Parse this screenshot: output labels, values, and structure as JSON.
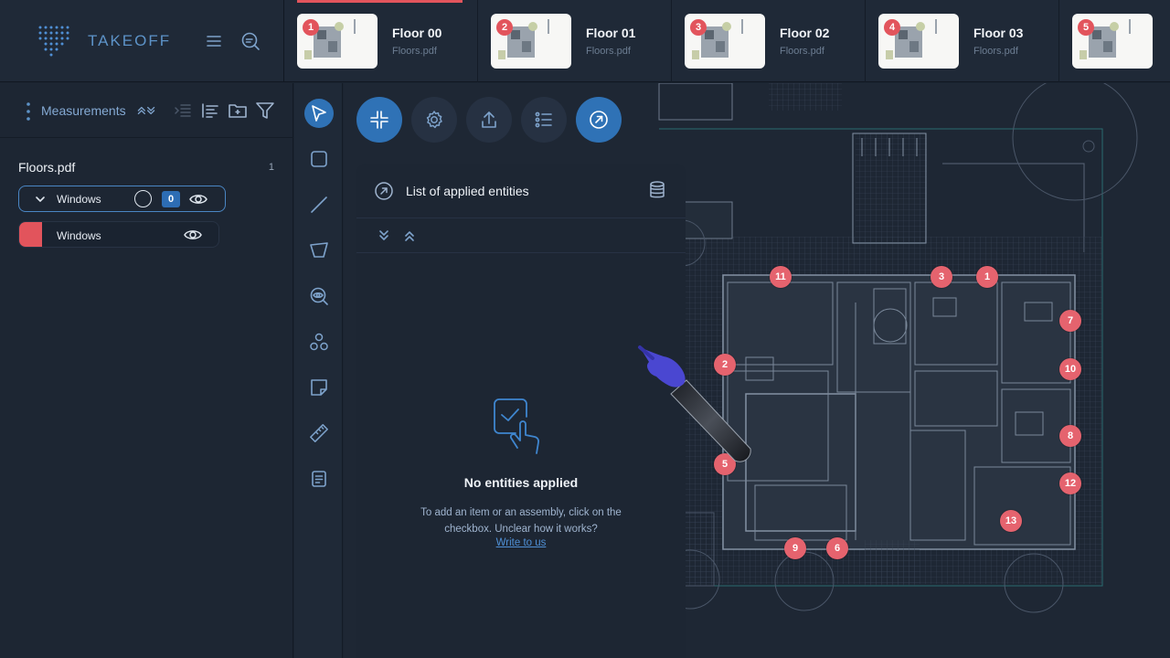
{
  "brand": {
    "name": "TAKEOFF"
  },
  "tabs": [
    {
      "badge": "1",
      "title": "Floor 00",
      "file": "Floors.pdf",
      "active": true
    },
    {
      "badge": "2",
      "title": "Floor 01",
      "file": "Floors.pdf",
      "active": false
    },
    {
      "badge": "3",
      "title": "Floor 02",
      "file": "Floors.pdf",
      "active": false
    },
    {
      "badge": "4",
      "title": "Floor 03",
      "file": "Floors.pdf",
      "active": false
    },
    {
      "badge": "5",
      "title": "",
      "file": "",
      "active": false
    }
  ],
  "sidebar": {
    "title": "Measurements",
    "file": {
      "name": "Floors.pdf",
      "count": "1"
    },
    "group": {
      "label": "Windows",
      "count": "0"
    },
    "item": {
      "label": "Windows",
      "color": "#e2545c"
    }
  },
  "entities": {
    "title": "List of applied entities",
    "empty_title": "No entities applied",
    "empty_hint": "To add an item or an assembly, click on the checkbox. Unclear how it works?",
    "link": "Write to us"
  },
  "markers": [
    {
      "label": "11"
    },
    {
      "label": "3"
    },
    {
      "label": "1"
    },
    {
      "label": "7"
    },
    {
      "label": "2"
    },
    {
      "label": "10"
    },
    {
      "label": "8"
    },
    {
      "label": "5"
    },
    {
      "label": "12"
    },
    {
      "label": "13"
    },
    {
      "label": "9"
    },
    {
      "label": "6"
    }
  ],
  "colors": {
    "accent": "#2f72b6",
    "marker": "#e5636e",
    "brand": "#5d93c8"
  }
}
